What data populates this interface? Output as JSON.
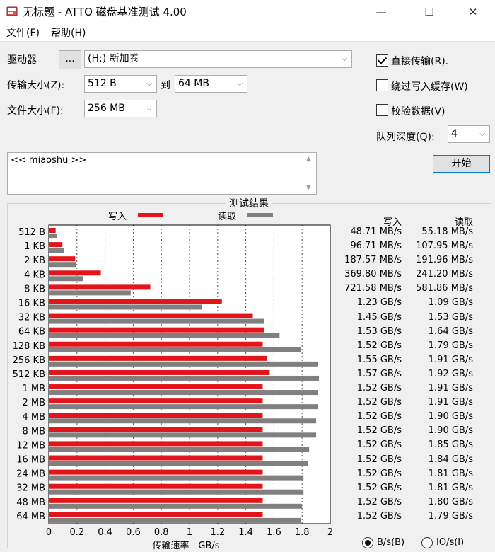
{
  "window": {
    "title": "无标题 - ATTO 磁盘基准测试 4.00",
    "minimize_glyph": "—",
    "maximize_glyph": "☐",
    "close_glyph": "✕",
    "icon": "disk-benchmark-icon"
  },
  "menu": {
    "file": "文件(F)",
    "help": "帮助(H)"
  },
  "settings": {
    "drive_label": "驱动器",
    "browse_label": "...",
    "drive_value": "(H:) 新加卷",
    "transfer_size_label": "传输大小(Z):",
    "transfer_from": "512 B",
    "to_label": "到",
    "transfer_to": "64 MB",
    "file_size_label": "文件大小(F):",
    "file_size": "256 MB",
    "direct_io_label": "直接传输(R).",
    "direct_io_checked": true,
    "bypass_cache_label": "绕过写入缓存(W)",
    "bypass_cache_checked": false,
    "verify_label": "校验数据(V)",
    "verify_checked": false,
    "queue_depth_label": "队列深度(Q):",
    "queue_depth": "4",
    "start_label": "开始",
    "description": "<< miaoshu >>"
  },
  "results": {
    "group_title": "测试结果",
    "legend_write": "写入",
    "legend_read": "读取",
    "col_write": "写入",
    "col_read": "读取",
    "rows": [
      {
        "size": "512 B",
        "write": "48.71 MB/s",
        "read": "55.18 MB/s"
      },
      {
        "size": "1 KB",
        "write": "96.71 MB/s",
        "read": "107.95 MB/s"
      },
      {
        "size": "2 KB",
        "write": "187.57 MB/s",
        "read": "191.96 MB/s"
      },
      {
        "size": "4 KB",
        "write": "369.80 MB/s",
        "read": "241.20 MB/s"
      },
      {
        "size": "8 KB",
        "write": "721.58 MB/s",
        "read": "581.86 MB/s"
      },
      {
        "size": "16 KB",
        "write": "1.23 GB/s",
        "read": "1.09 GB/s"
      },
      {
        "size": "32 KB",
        "write": "1.45 GB/s",
        "read": "1.53 GB/s"
      },
      {
        "size": "64 KB",
        "write": "1.53 GB/s",
        "read": "1.64 GB/s"
      },
      {
        "size": "128 KB",
        "write": "1.52 GB/s",
        "read": "1.79 GB/s"
      },
      {
        "size": "256 KB",
        "write": "1.55 GB/s",
        "read": "1.91 GB/s"
      },
      {
        "size": "512 KB",
        "write": "1.57 GB/s",
        "read": "1.92 GB/s"
      },
      {
        "size": "1 MB",
        "write": "1.52 GB/s",
        "read": "1.91 GB/s"
      },
      {
        "size": "2 MB",
        "write": "1.52 GB/s",
        "read": "1.91 GB/s"
      },
      {
        "size": "4 MB",
        "write": "1.52 GB/s",
        "read": "1.90 GB/s"
      },
      {
        "size": "8 MB",
        "write": "1.52 GB/s",
        "read": "1.90 GB/s"
      },
      {
        "size": "12 MB",
        "write": "1.52 GB/s",
        "read": "1.85 GB/s"
      },
      {
        "size": "16 MB",
        "write": "1.52 GB/s",
        "read": "1.84 GB/s"
      },
      {
        "size": "24 MB",
        "write": "1.52 GB/s",
        "read": "1.81 GB/s"
      },
      {
        "size": "32 MB",
        "write": "1.52 GB/s",
        "read": "1.81 GB/s"
      },
      {
        "size": "48 MB",
        "write": "1.52 GB/s",
        "read": "1.80 GB/s"
      },
      {
        "size": "64 MB",
        "write": "1.52 GB/s",
        "read": "1.79 GB/s"
      }
    ],
    "unit_bytes_label": "B/s(B)",
    "unit_bytes_selected": true,
    "unit_io_label": "IO/s(I)",
    "unit_io_selected": false
  },
  "chart_data": {
    "type": "bar",
    "orientation": "horizontal",
    "categories": [
      "512 B",
      "1 KB",
      "2 KB",
      "4 KB",
      "8 KB",
      "16 KB",
      "32 KB",
      "64 KB",
      "128 KB",
      "256 KB",
      "512 KB",
      "1 MB",
      "2 MB",
      "4 MB",
      "8 MB",
      "12 MB",
      "16 MB",
      "24 MB",
      "32 MB",
      "48 MB",
      "64 MB"
    ],
    "series": [
      {
        "name": "写入",
        "color": "#e3151a",
        "values": [
          0.04871,
          0.09671,
          0.18757,
          0.3698,
          0.72158,
          1.23,
          1.45,
          1.53,
          1.52,
          1.55,
          1.57,
          1.52,
          1.52,
          1.52,
          1.52,
          1.52,
          1.52,
          1.52,
          1.52,
          1.52,
          1.52
        ]
      },
      {
        "name": "读取",
        "color": "#808080",
        "values": [
          0.05518,
          0.10795,
          0.19196,
          0.2412,
          0.58186,
          1.09,
          1.53,
          1.64,
          1.79,
          1.91,
          1.92,
          1.91,
          1.91,
          1.9,
          1.9,
          1.85,
          1.84,
          1.81,
          1.81,
          1.8,
          1.79
        ]
      }
    ],
    "xlabel": "传输速率 - GB/s",
    "xlim": [
      0,
      2
    ],
    "xticks": [
      "0",
      "0.2",
      "0.4",
      "0.6",
      "0.8",
      "1",
      "1.2",
      "1.4",
      "1.6",
      "1.8",
      "2"
    ],
    "grid": true,
    "legend": "top"
  }
}
